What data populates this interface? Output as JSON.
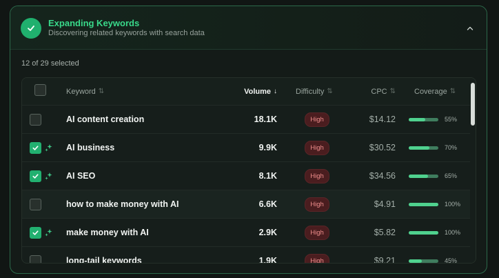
{
  "header": {
    "title": "Expanding Keywords",
    "subtitle": "Discovering related keywords with search data",
    "status_icon": "check-icon",
    "collapse_icon": "chevron-up-icon"
  },
  "selection": {
    "summary": "12 of 29 selected"
  },
  "table": {
    "columns": {
      "keyword": "Keyword",
      "volume": "Volume",
      "difficulty": "Difficulty",
      "cpc": "CPC",
      "coverage": "Coverage"
    },
    "sort": {
      "column": "volume",
      "direction": "desc",
      "active_icon": "arrow-down-icon",
      "inactive_icon": "sort-icon"
    },
    "rows": [
      {
        "checked": false,
        "keyword": "AI content creation",
        "volume": "18.1K",
        "difficulty": "High",
        "cpc": "$14.12",
        "coverage_pct": 55,
        "coverage": "55%"
      },
      {
        "checked": true,
        "keyword": "AI business",
        "volume": "9.9K",
        "difficulty": "High",
        "cpc": "$30.52",
        "coverage_pct": 70,
        "coverage": "70%"
      },
      {
        "checked": true,
        "keyword": "AI SEO",
        "volume": "8.1K",
        "difficulty": "High",
        "cpc": "$34.56",
        "coverage_pct": 65,
        "coverage": "65%"
      },
      {
        "checked": false,
        "keyword": "how to make money with AI",
        "volume": "6.6K",
        "difficulty": "High",
        "cpc": "$4.91",
        "coverage_pct": 100,
        "coverage": "100%"
      },
      {
        "checked": true,
        "keyword": "make money with AI",
        "volume": "2.9K",
        "difficulty": "High",
        "cpc": "$5.82",
        "coverage_pct": 100,
        "coverage": "100%"
      },
      {
        "checked": false,
        "keyword": "long-tail keywords",
        "volume": "1.9K",
        "difficulty": "High",
        "cpc": "$9.21",
        "coverage_pct": 45,
        "coverage": "45%"
      }
    ]
  },
  "colors": {
    "accent": "#20b06e",
    "title": "#39d98a",
    "difficulty_high_bg": "#4a1d1f",
    "difficulty_high_text": "#ef8e8c"
  }
}
